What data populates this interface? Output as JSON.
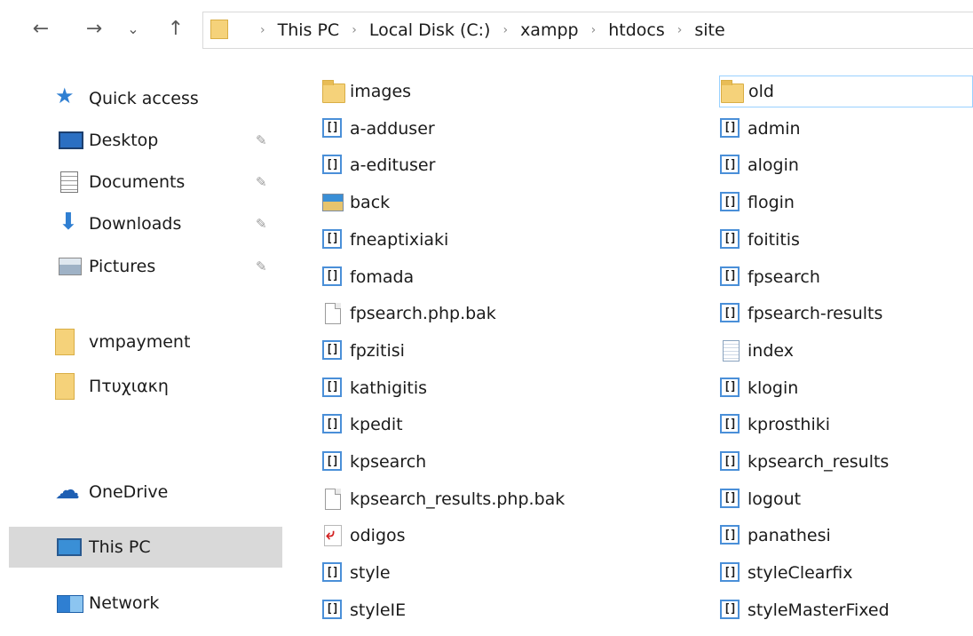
{
  "nav": {
    "back_icon": "←",
    "forward_icon": "→",
    "recent_icon": "⌄",
    "up_icon": "↑"
  },
  "breadcrumbs": [
    "This PC",
    "Local Disk (C:)",
    "xampp",
    "htdocs",
    "site"
  ],
  "sidebar": {
    "items": [
      {
        "label": "Quick access",
        "icon": "star-icon"
      },
      {
        "label": "Desktop",
        "icon": "desktop-icon",
        "pinned": true
      },
      {
        "label": "Documents",
        "icon": "documents-icon",
        "pinned": true
      },
      {
        "label": "Downloads",
        "icon": "download-arrow-icon",
        "pinned": true
      },
      {
        "label": "Pictures",
        "icon": "pictures-icon",
        "pinned": true
      },
      {
        "label": "vmpayment",
        "icon": "folder-icon"
      },
      {
        "label": "Πτυχιακη",
        "icon": "folder-icon"
      },
      {
        "label": "OneDrive",
        "icon": "cloud-icon"
      },
      {
        "label": "This PC",
        "icon": "computer-icon",
        "selected": true
      },
      {
        "label": "Network",
        "icon": "network-icon"
      }
    ]
  },
  "files": {
    "left": [
      {
        "name": "images",
        "type": "folder"
      },
      {
        "name": "a-adduser",
        "type": "php"
      },
      {
        "name": "a-edituser",
        "type": "php"
      },
      {
        "name": "back",
        "type": "image"
      },
      {
        "name": "fneaptixiaki",
        "type": "php"
      },
      {
        "name": "fomada",
        "type": "php"
      },
      {
        "name": "fpsearch.php.bak",
        "type": "blank"
      },
      {
        "name": "fpzitisi",
        "type": "php"
      },
      {
        "name": "kathigitis",
        "type": "php"
      },
      {
        "name": "kpedit",
        "type": "php"
      },
      {
        "name": "kpsearch",
        "type": "php"
      },
      {
        "name": "kpsearch_results.php.bak",
        "type": "blank"
      },
      {
        "name": "odigos",
        "type": "pdf"
      },
      {
        "name": "style",
        "type": "php"
      },
      {
        "name": "styleIE",
        "type": "php"
      }
    ],
    "right": [
      {
        "name": "old",
        "type": "folder",
        "selected": true
      },
      {
        "name": "admin",
        "type": "php"
      },
      {
        "name": "alogin",
        "type": "php"
      },
      {
        "name": "flogin",
        "type": "php"
      },
      {
        "name": "foititis",
        "type": "php"
      },
      {
        "name": "fpsearch",
        "type": "php"
      },
      {
        "name": "fpsearch-results",
        "type": "php"
      },
      {
        "name": "index",
        "type": "text"
      },
      {
        "name": "klogin",
        "type": "php"
      },
      {
        "name": "kprosthiki",
        "type": "php"
      },
      {
        "name": "kpsearch_results",
        "type": "php"
      },
      {
        "name": "logout",
        "type": "php"
      },
      {
        "name": "panathesi",
        "type": "php"
      },
      {
        "name": "styleClearfix",
        "type": "php"
      },
      {
        "name": "styleMasterFixed",
        "type": "php"
      }
    ]
  },
  "colors": {
    "selection": "#d9d9d9",
    "folder": "#f5d27a",
    "php_border": "#4a8fd8"
  }
}
